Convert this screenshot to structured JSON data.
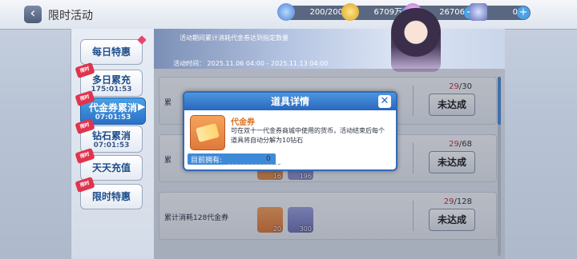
{
  "header": {
    "title": "限时活动",
    "back_icon": "back-arrow-icon"
  },
  "resources": [
    {
      "icon": "stamina-icon",
      "value": "200/200"
    },
    {
      "icon": "gold-coin-icon",
      "value": "6709万"
    },
    {
      "icon": "diamond-icon",
      "value": "26706"
    },
    {
      "icon": "ticket-icon",
      "value": "0"
    }
  ],
  "sidebar": {
    "tabs": [
      {
        "label": "每日特惠",
        "timer": "",
        "badge": ""
      },
      {
        "label": "多日累充",
        "timer": "175:01:53",
        "badge": "限时"
      },
      {
        "label": "代金券累消",
        "timer": "07:01:53",
        "badge": "限时"
      },
      {
        "label": "钻石累消",
        "timer": "07:01:53",
        "badge": "限时"
      },
      {
        "label": "天天充值",
        "timer": "",
        "badge": "限时"
      },
      {
        "label": "限时特惠",
        "timer": "",
        "badge": "限时"
      }
    ]
  },
  "banner": {
    "desc": "活动期间累计消耗代金券达到指定数量",
    "time_label": "活动时间：",
    "time": "2025.11.06 04:00 - 2025.11.13 04:00"
  },
  "rows": [
    {
      "name": "累",
      "progress_current": "29",
      "progress_total": "/30",
      "button": "未达成"
    },
    {
      "name": "累",
      "progress_current": "29",
      "progress_total": "/68",
      "button": "未达成",
      "items": [
        "16",
        "196"
      ]
    },
    {
      "name": "累计消耗128代金券",
      "progress_current": "29",
      "progress_total": "/128",
      "button": "未达成",
      "items": [
        "20",
        "300"
      ]
    }
  ],
  "dialog": {
    "title": "道具详情",
    "close_icon": "close-icon",
    "item_name": "代金券",
    "item_desc": "可在双十一代金券商城中使用的货币，活动结束后每个道具将自动分解为10钻石",
    "owned_label": "目前拥有:",
    "owned_value": "0"
  },
  "colors": {
    "accent": "#2a67bd",
    "highlight": "#e07020",
    "progress_red": "#c9303d"
  }
}
